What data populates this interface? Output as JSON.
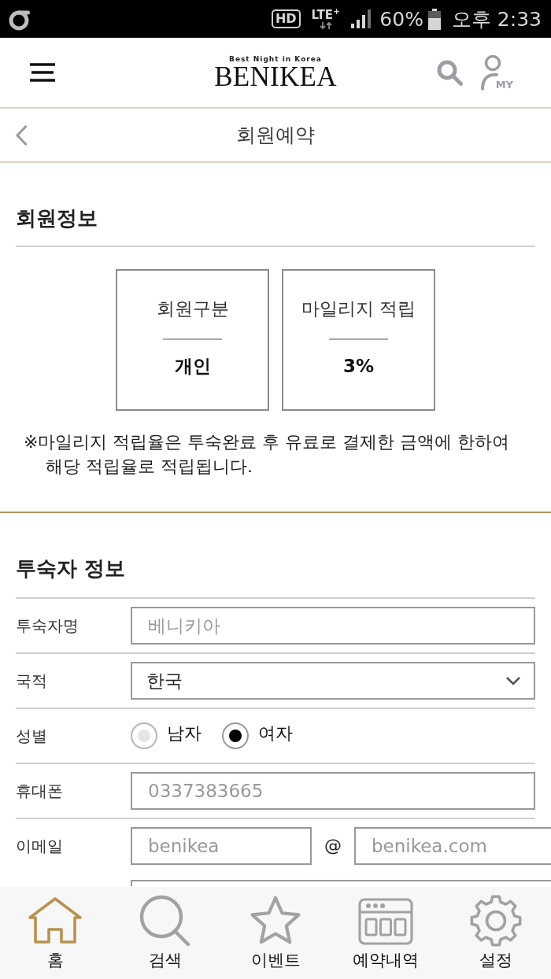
{
  "status_bar": {
    "hd_badge": "HD",
    "network": "LTE$^{+}$",
    "battery": "60%",
    "time": "오후 2:33"
  },
  "header": {
    "logo_tagline": "Best Night in Korea",
    "logo": "BENIKEA",
    "my_label": "MY"
  },
  "page_header": {
    "title": "회원예약"
  },
  "member_info": {
    "heading": "회원정보",
    "cards": [
      {
        "label": "회원구분",
        "value": "개인"
      },
      {
        "label": "마일리지 적립",
        "value": "3%"
      }
    ],
    "note": "※마일리지 적립율은 투숙완료 후 유료로 결제한 금액에 한하여 해당 적립율로 적립됩니다."
  },
  "guest_info": {
    "heading": "투숙자 정보",
    "fields": [
      {
        "kind": "text",
        "label": "투숙자명",
        "placeholder": "베니키아"
      },
      {
        "kind": "select",
        "label": "국적",
        "value": "한국"
      },
      {
        "kind": "radio",
        "label": "성별",
        "options": [
          {
            "label": "남자",
            "selected": false
          },
          {
            "label": "여자",
            "selected": true
          }
        ]
      },
      {
        "kind": "text",
        "label": "휴대폰",
        "placeholder": "0337383665"
      },
      {
        "kind": "email",
        "label": "이메일",
        "local_placeholder": "benikea",
        "separator": "@",
        "domain_placeholder": "benikea.com",
        "partial_field_below": true
      }
    ]
  },
  "bottom_nav": [
    {
      "label": "홈",
      "selected": true
    },
    {
      "label": "검색",
      "selected": false
    },
    {
      "label": "이벤트",
      "selected": false
    },
    {
      "label": "예약내역",
      "selected": false
    },
    {
      "label": "설정",
      "selected": false
    }
  ]
}
